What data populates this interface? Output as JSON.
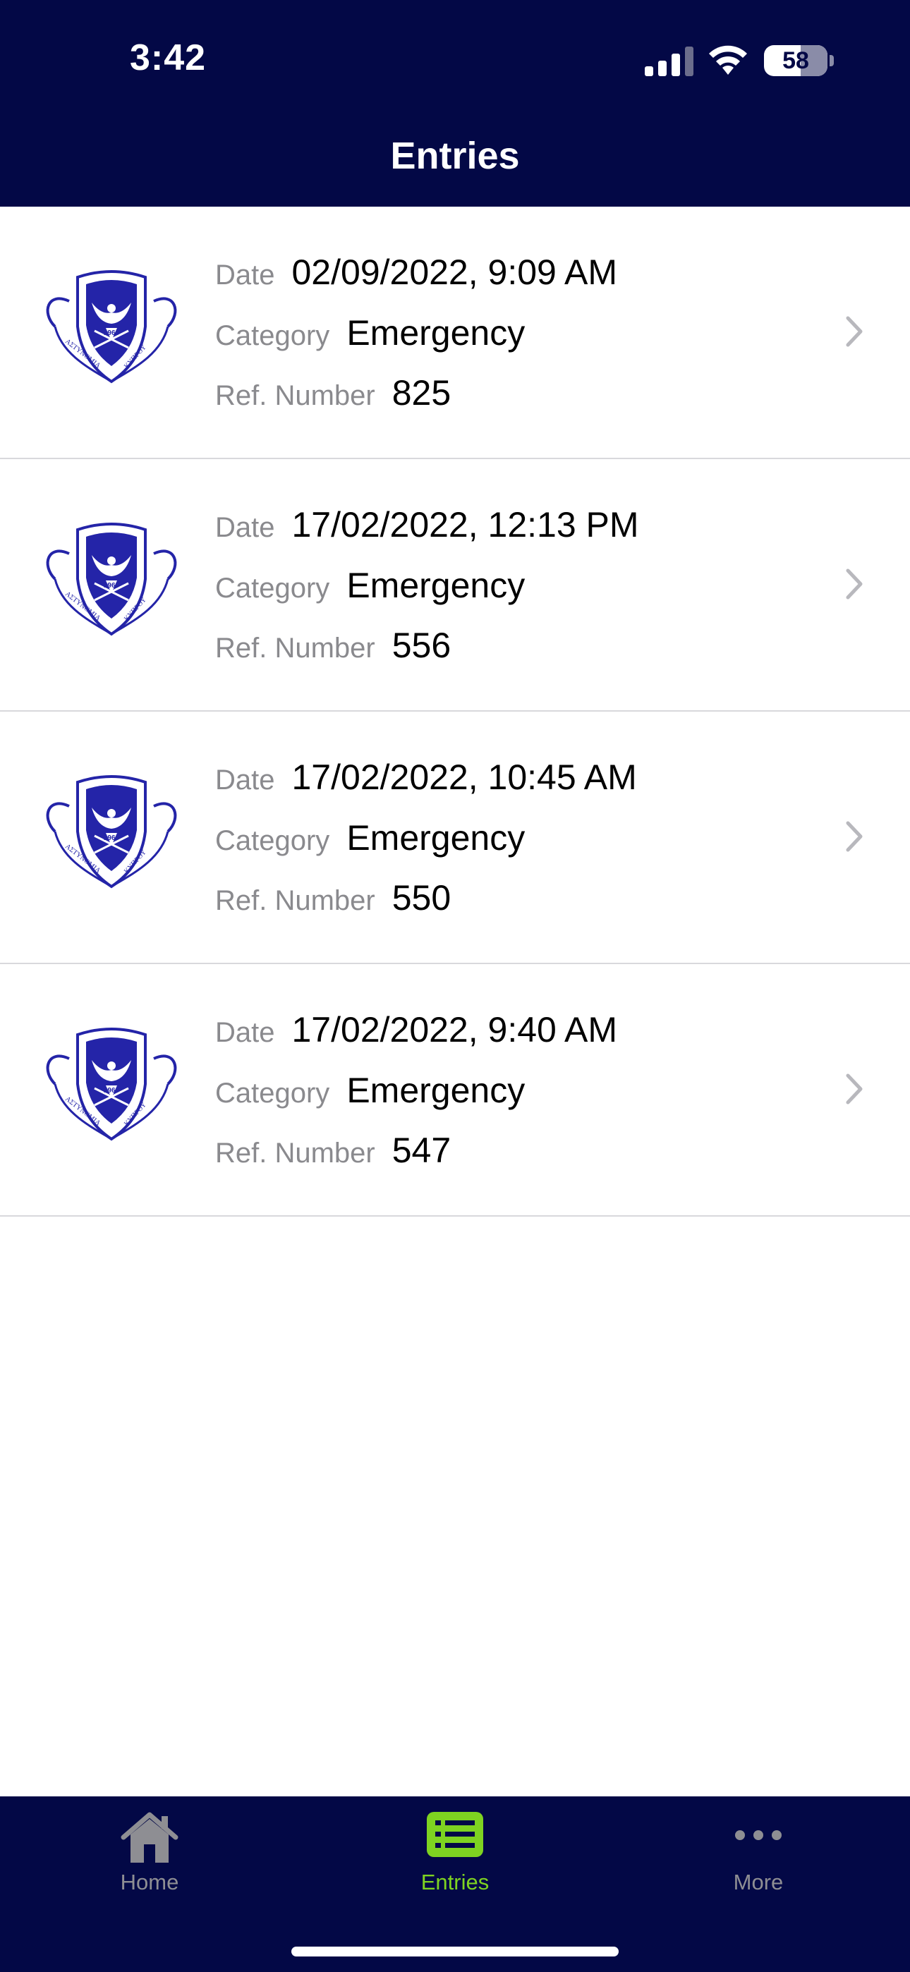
{
  "status_bar": {
    "time": "3:42",
    "battery": "58"
  },
  "header": {
    "title": "Entries"
  },
  "labels": {
    "date": "Date",
    "category": "Category",
    "ref": "Ref. Number"
  },
  "entries": [
    {
      "date": "02/09/2022, 9:09 AM",
      "category": "Emergency",
      "ref": "825"
    },
    {
      "date": "17/02/2022, 12:13 PM",
      "category": "Emergency",
      "ref": "556"
    },
    {
      "date": "17/02/2022, 10:45 AM",
      "category": "Emergency",
      "ref": "550"
    },
    {
      "date": "17/02/2022, 9:40 AM",
      "category": "Emergency",
      "ref": "547"
    }
  ],
  "crest": {
    "text_left": "ΑΣΤΥΝΟΜΙΑ",
    "text_right": "ΚΥΠΡΟΥ",
    "year": "1960"
  },
  "tab_bar": {
    "tabs": [
      {
        "label": "Home",
        "icon": "house-icon",
        "active": false
      },
      {
        "label": "Entries",
        "icon": "list-icon",
        "active": true
      },
      {
        "label": "More",
        "icon": "ellipsis-icon",
        "active": false
      }
    ]
  },
  "colors": {
    "header_bg": "#030846",
    "accent": "#7ed321",
    "crest_blue": "#2424a8"
  }
}
